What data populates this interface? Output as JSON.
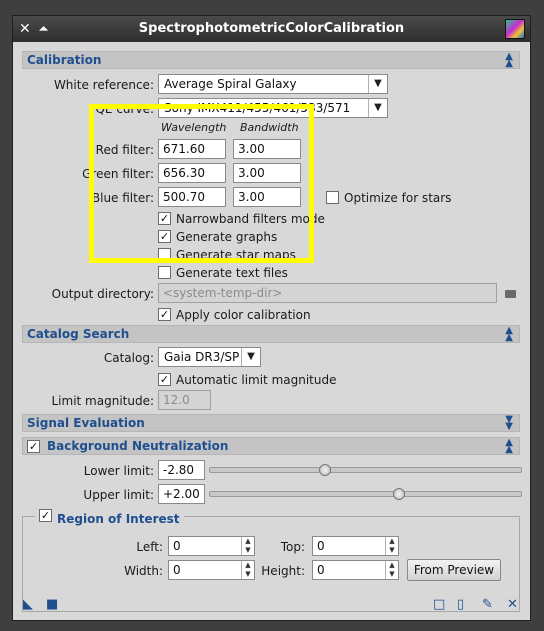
{
  "window": {
    "title": "SpectrophotometricColorCalibration"
  },
  "icons": {
    "close": "close-icon",
    "shade": "shade-icon",
    "app": "app-icon"
  },
  "calibration": {
    "header": "Calibration",
    "white_reference_label": "White reference:",
    "white_reference_value": "Average Spiral Galaxy",
    "qe_curve_label": "QE curve:",
    "qe_curve_value": "Sony IMX411/455/461/533/571",
    "col_wavelength": "Wavelength",
    "col_bandwidth": "Bandwidth",
    "red_label": "Red filter:",
    "red_wavelength": "671.60",
    "red_bandwidth": "3.00",
    "green_label": "Green filter:",
    "green_wavelength": "656.30",
    "green_bandwidth": "3.00",
    "blue_label": "Blue filter:",
    "blue_wavelength": "500.70",
    "blue_bandwidth": "3.00",
    "optimize_label": "Optimize for stars",
    "narrowband_label": "Narrowband filters mode",
    "graphs_label": "Generate graphs",
    "starmaps_label": "Generate star maps",
    "textfiles_label": "Generate text files",
    "output_dir_label": "Output directory:",
    "output_dir_value": "<system-temp-dir>",
    "apply_label": "Apply color calibration",
    "optimize_checked": false,
    "narrowband_checked": true,
    "graphs_checked": true,
    "starmaps_checked": false,
    "textfiles_checked": false,
    "apply_checked": true
  },
  "catalog": {
    "header": "Catalog Search",
    "catalog_label": "Catalog:",
    "catalog_value": "Gaia DR3/SP",
    "auto_limit_label": "Automatic limit magnitude",
    "auto_limit_checked": true,
    "limit_mag_label": "Limit magnitude:",
    "limit_mag_value": "12.0"
  },
  "signal": {
    "header": "Signal Evaluation"
  },
  "background": {
    "header": "Background Neutralization",
    "checked": true,
    "lower_label": "Lower limit:",
    "lower_value": "-2.80",
    "upper_label": "Upper limit:",
    "upper_value": "+2.00",
    "lower_fraction": 0.365,
    "upper_fraction": 0.605
  },
  "roi": {
    "header": "Region of Interest",
    "checked": true,
    "left_label": "Left:",
    "left_value": "0",
    "top_label": "Top:",
    "top_value": "0",
    "width_label": "Width:",
    "width_value": "0",
    "height_label": "Height:",
    "height_value": "0",
    "from_preview": "From Preview"
  },
  "check_glyph": "✓",
  "colors": {
    "accent": "#1f4f8f",
    "highlight": "#ffff00",
    "titlebar": "#333333"
  }
}
